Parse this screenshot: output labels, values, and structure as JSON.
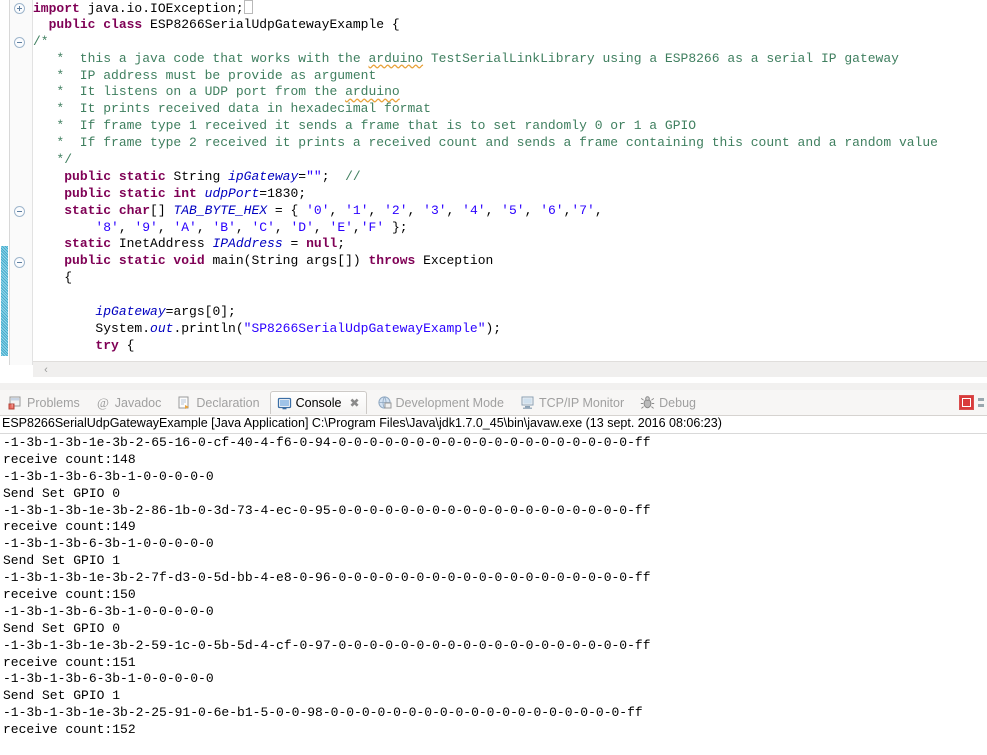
{
  "editor": {
    "name": "java-editor",
    "scroll_left_arrow": "‹",
    "lines": [
      {
        "fold": "plus",
        "change": false,
        "tokens": [
          {
            "t": "kw",
            "s": "import"
          },
          {
            "t": "plain",
            "s": " java.io.IOException;"
          },
          {
            "t": "caret",
            "s": ""
          }
        ]
      },
      {
        "fold": null,
        "change": false,
        "tokens": [
          {
            "t": "plain",
            "s": "  "
          },
          {
            "t": "kw",
            "s": "public class"
          },
          {
            "t": "plain",
            "s": " ESP8266SerialUdpGatewayExample {"
          }
        ]
      },
      {
        "fold": "minus",
        "change": false,
        "tokens": [
          {
            "t": "cmt",
            "s": "/*"
          }
        ]
      },
      {
        "fold": null,
        "change": false,
        "tokens": [
          {
            "t": "cmt",
            "s": "   *  this a java code that works with the "
          },
          {
            "t": "cmt-spell",
            "s": "arduino"
          },
          {
            "t": "cmt",
            "s": " TestSerialLinkLibrary using a ESP8266 as a serial IP gateway"
          }
        ]
      },
      {
        "fold": null,
        "change": false,
        "tokens": [
          {
            "t": "cmt",
            "s": "   *  IP address must be provide as argument"
          }
        ]
      },
      {
        "fold": null,
        "change": false,
        "tokens": [
          {
            "t": "cmt",
            "s": "   *  It listens on a UDP port from the "
          },
          {
            "t": "cmt-spell",
            "s": "arduino"
          }
        ]
      },
      {
        "fold": null,
        "change": false,
        "tokens": [
          {
            "t": "cmt",
            "s": "   *  It prints received data in hexadecimal format"
          }
        ]
      },
      {
        "fold": null,
        "change": false,
        "tokens": [
          {
            "t": "cmt",
            "s": "   *  If frame type 1 received it sends a frame that is to set randomly 0 or 1 a GPIO"
          }
        ]
      },
      {
        "fold": null,
        "change": false,
        "tokens": [
          {
            "t": "cmt",
            "s": "   *  If frame type 2 received it prints a received count and sends a frame containing this count and a random value"
          }
        ]
      },
      {
        "fold": null,
        "change": false,
        "tokens": [
          {
            "t": "cmt",
            "s": "   */"
          }
        ]
      },
      {
        "fold": null,
        "change": false,
        "tokens": [
          {
            "t": "plain",
            "s": "    "
          },
          {
            "t": "kw",
            "s": "public static"
          },
          {
            "t": "plain",
            "s": " String "
          },
          {
            "t": "fld",
            "s": "ipGateway"
          },
          {
            "t": "plain",
            "s": "="
          },
          {
            "t": "str",
            "s": "\"\""
          },
          {
            "t": "plain",
            "s": ";  "
          },
          {
            "t": "cmt",
            "s": "//"
          }
        ]
      },
      {
        "fold": null,
        "change": false,
        "tokens": [
          {
            "t": "plain",
            "s": "    "
          },
          {
            "t": "kw",
            "s": "public static int"
          },
          {
            "t": "plain",
            "s": " "
          },
          {
            "t": "fld",
            "s": "udpPort"
          },
          {
            "t": "plain",
            "s": "=1830;"
          }
        ]
      },
      {
        "fold": "minus",
        "change": false,
        "tokens": [
          {
            "t": "plain",
            "s": "    "
          },
          {
            "t": "kw",
            "s": "static char"
          },
          {
            "t": "plain",
            "s": "[] "
          },
          {
            "t": "fld",
            "s": "TAB_BYTE_HEX"
          },
          {
            "t": "plain",
            "s": " = { "
          },
          {
            "t": "str",
            "s": "'0'"
          },
          {
            "t": "plain",
            "s": ", "
          },
          {
            "t": "str",
            "s": "'1'"
          },
          {
            "t": "plain",
            "s": ", "
          },
          {
            "t": "str",
            "s": "'2'"
          },
          {
            "t": "plain",
            "s": ", "
          },
          {
            "t": "str",
            "s": "'3'"
          },
          {
            "t": "plain",
            "s": ", "
          },
          {
            "t": "str",
            "s": "'4'"
          },
          {
            "t": "plain",
            "s": ", "
          },
          {
            "t": "str",
            "s": "'5'"
          },
          {
            "t": "plain",
            "s": ", "
          },
          {
            "t": "str",
            "s": "'6'"
          },
          {
            "t": "plain",
            "s": ","
          },
          {
            "t": "str",
            "s": "'7'"
          },
          {
            "t": "plain",
            "s": ","
          }
        ]
      },
      {
        "fold": null,
        "change": false,
        "tokens": [
          {
            "t": "plain",
            "s": "        "
          },
          {
            "t": "str",
            "s": "'8'"
          },
          {
            "t": "plain",
            "s": ", "
          },
          {
            "t": "str",
            "s": "'9'"
          },
          {
            "t": "plain",
            "s": ", "
          },
          {
            "t": "str",
            "s": "'A'"
          },
          {
            "t": "plain",
            "s": ", "
          },
          {
            "t": "str",
            "s": "'B'"
          },
          {
            "t": "plain",
            "s": ", "
          },
          {
            "t": "str",
            "s": "'C'"
          },
          {
            "t": "plain",
            "s": ", "
          },
          {
            "t": "str",
            "s": "'D'"
          },
          {
            "t": "plain",
            "s": ", "
          },
          {
            "t": "str",
            "s": "'E'"
          },
          {
            "t": "plain",
            "s": ","
          },
          {
            "t": "str",
            "s": "'F'"
          },
          {
            "t": "plain",
            "s": " };"
          }
        ]
      },
      {
        "fold": null,
        "change": true,
        "tokens": [
          {
            "t": "plain",
            "s": "    "
          },
          {
            "t": "kw",
            "s": "static"
          },
          {
            "t": "plain",
            "s": " InetAddress "
          },
          {
            "t": "fld",
            "s": "IPAddress"
          },
          {
            "t": "plain",
            "s": " = "
          },
          {
            "t": "kw",
            "s": "null"
          },
          {
            "t": "plain",
            "s": ";"
          }
        ]
      },
      {
        "fold": "minus",
        "change": true,
        "tokens": [
          {
            "t": "plain",
            "s": "    "
          },
          {
            "t": "kw",
            "s": "public static void"
          },
          {
            "t": "plain",
            "s": " main(String args[]) "
          },
          {
            "t": "kw",
            "s": "throws"
          },
          {
            "t": "plain",
            "s": " Exception"
          }
        ]
      },
      {
        "fold": null,
        "change": true,
        "tokens": [
          {
            "t": "plain",
            "s": "    {"
          }
        ]
      },
      {
        "fold": null,
        "change": true,
        "tokens": [
          {
            "t": "plain",
            "s": ""
          }
        ]
      },
      {
        "fold": null,
        "change": true,
        "tokens": [
          {
            "t": "plain",
            "s": "        "
          },
          {
            "t": "fld",
            "s": "ipGateway"
          },
          {
            "t": "plain",
            "s": "=args[0];"
          }
        ]
      },
      {
        "fold": null,
        "change": true,
        "tokens": [
          {
            "t": "plain",
            "s": "        System."
          },
          {
            "t": "fld",
            "s": "out"
          },
          {
            "t": "plain",
            "s": ".println("
          },
          {
            "t": "str",
            "s": "\"SP8266SerialUdpGatewayExample\""
          },
          {
            "t": "plain",
            "s": ");"
          }
        ]
      },
      {
        "fold": null,
        "change": true,
        "tokens": [
          {
            "t": "plain",
            "s": "        "
          },
          {
            "t": "kw",
            "s": "try"
          },
          {
            "t": "plain",
            "s": " {"
          }
        ]
      },
      {
        "fold": null,
        "change": true,
        "tokens": [
          {
            "t": "plain",
            "s": ""
          }
        ]
      },
      {
        "fold": null,
        "change": true,
        "tokens": [
          {
            "t": "plain",
            "s": ""
          }
        ]
      }
    ]
  },
  "view_tabs": [
    {
      "label": "Problems",
      "icon": "problems-icon",
      "active": false,
      "closable": false
    },
    {
      "label": "Javadoc",
      "icon": "javadoc-icon",
      "active": false,
      "closable": false
    },
    {
      "label": "Declaration",
      "icon": "declaration-icon",
      "active": false,
      "closable": false
    },
    {
      "label": "Console",
      "icon": "console-icon",
      "active": true,
      "closable": true
    },
    {
      "label": "Development Mode",
      "icon": "development-mode-icon",
      "active": false,
      "closable": false
    },
    {
      "label": "TCP/IP Monitor",
      "icon": "tcpip-monitor-icon",
      "active": false,
      "closable": false
    },
    {
      "label": "Debug",
      "icon": "debug-icon",
      "active": false,
      "closable": false
    }
  ],
  "console": {
    "close_glyph": "✖",
    "toolbar": {
      "stop_label": "Terminate",
      "more_label": "View Menu"
    },
    "header": "ESP8266SerialUdpGatewayExample [Java Application] C:\\Program Files\\Java\\jdk1.7.0_45\\bin\\javaw.exe (13 sept. 2016 08:06:23)",
    "output_lines": [
      "-1-3b-1-3b-1e-3b-2-65-16-0-cf-40-4-f6-0-94-0-0-0-0-0-0-0-0-0-0-0-0-0-0-0-0-0-0-0-ff",
      "receive count:148",
      "-1-3b-1-3b-6-3b-1-0-0-0-0-0",
      "Send Set GPIO 0",
      "-1-3b-1-3b-1e-3b-2-86-1b-0-3d-73-4-ec-0-95-0-0-0-0-0-0-0-0-0-0-0-0-0-0-0-0-0-0-0-ff",
      "receive count:149",
      "-1-3b-1-3b-6-3b-1-0-0-0-0-0",
      "Send Set GPIO 1",
      "-1-3b-1-3b-1e-3b-2-7f-d3-0-5d-bb-4-e8-0-96-0-0-0-0-0-0-0-0-0-0-0-0-0-0-0-0-0-0-0-ff",
      "receive count:150",
      "-1-3b-1-3b-6-3b-1-0-0-0-0-0",
      "Send Set GPIO 0",
      "-1-3b-1-3b-1e-3b-2-59-1c-0-5b-5d-4-cf-0-97-0-0-0-0-0-0-0-0-0-0-0-0-0-0-0-0-0-0-0-ff",
      "receive count:151",
      "-1-3b-1-3b-6-3b-1-0-0-0-0-0",
      "Send Set GPIO 1",
      "-1-3b-1-3b-1e-3b-2-25-91-0-6e-b1-5-0-0-98-0-0-0-0-0-0-0-0-0-0-0-0-0-0-0-0-0-0-0-ff",
      "receive count:152"
    ]
  },
  "colors": {
    "keyword": "#7f0055",
    "comment": "#3f7f5f",
    "string": "#2a00ff",
    "field": "#0000c0",
    "stop_red": "#d93b3b",
    "change_bar": "#3aa7c9",
    "spell_squiggle": "#e8a33d"
  }
}
